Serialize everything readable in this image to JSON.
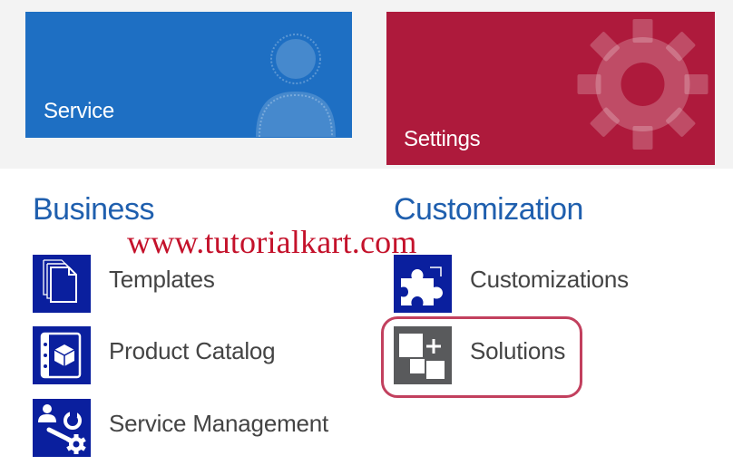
{
  "tiles": {
    "service": {
      "label": "Service",
      "color": "#1e6fc3",
      "icon": "person-icon"
    },
    "settings": {
      "label": "Settings",
      "color": "#ae1a3c",
      "icon": "gear-icon"
    }
  },
  "sections": {
    "business": {
      "heading": "Business",
      "items": [
        {
          "label": "Templates",
          "icon": "document-stack-icon"
        },
        {
          "label": "Product Catalog",
          "icon": "product-box-icon"
        },
        {
          "label": "Service Management",
          "icon": "user-tools-icon"
        }
      ]
    },
    "customization": {
      "heading": "Customization",
      "items": [
        {
          "label": "Customizations",
          "icon": "puzzle-icon"
        },
        {
          "label": "Solutions",
          "icon": "solutions-blocks-icon"
        }
      ]
    }
  },
  "watermark": "www.tutorialkart.com",
  "colors": {
    "heading": "#1f5fae",
    "icon_bg": "#0a1f9e",
    "solutions_icon_bg": "#595a5c",
    "highlight": "#c2405e",
    "watermark": "#c4122b"
  }
}
